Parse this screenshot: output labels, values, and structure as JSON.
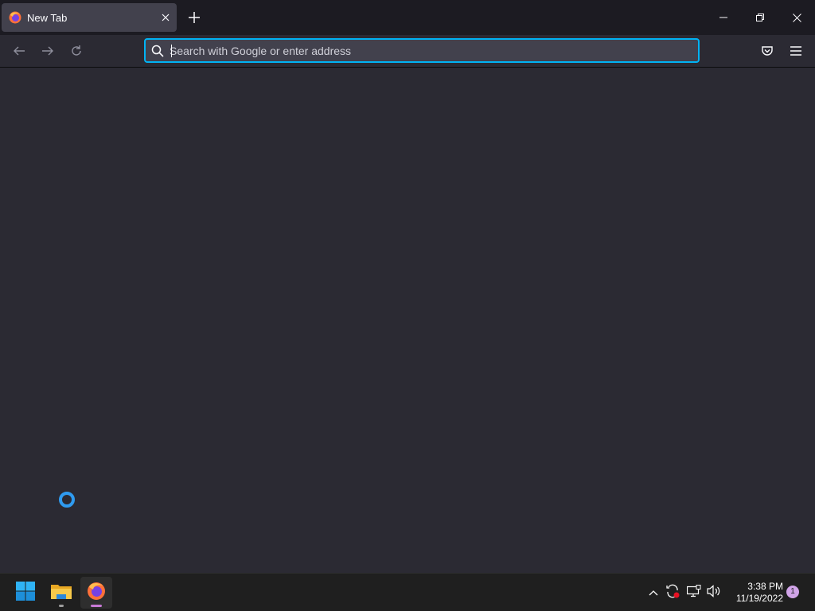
{
  "browser": {
    "tabs": [
      {
        "title": "New Tab",
        "active": true
      }
    ],
    "new_tab_label": "+",
    "urlbar": {
      "placeholder": "Search with Google or enter address",
      "value": ""
    }
  },
  "taskbar": {
    "apps": [
      {
        "name": "Start",
        "icon": "windows-start-icon"
      },
      {
        "name": "File Explorer",
        "icon": "folder-icon"
      },
      {
        "name": "Firefox",
        "icon": "firefox-icon",
        "active": true
      }
    ],
    "clock": {
      "time": "3:38 PM",
      "date": "11/19/2022"
    },
    "notification_count": "1"
  },
  "colors": {
    "accent": "#00b3f4",
    "background": "#2b2a33",
    "tabstrip": "#1c1b22",
    "spinner": "#2f9bf0"
  }
}
